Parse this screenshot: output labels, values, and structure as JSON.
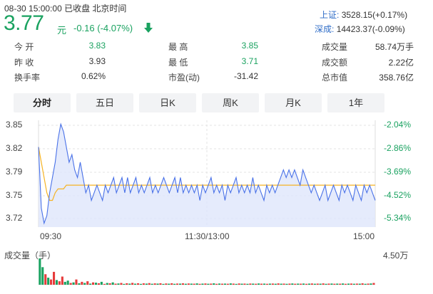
{
  "header": {
    "status": "08-30 15:00:00  已收盘  北京时间",
    "price": "3.77",
    "unit": "元",
    "change": "-0.16 (-4.07%)",
    "arrow_icon": "down-arrow-icon",
    "color_down": "#1aa260"
  },
  "indices": [
    {
      "label": "上证:",
      "value": "3528.15(+0.17%)"
    },
    {
      "label": "深成:",
      "value": "14423.37(-0.09%)"
    }
  ],
  "quote": {
    "open": {
      "label": "今 开",
      "value": "3.83"
    },
    "prev_close": {
      "label": "昨 收",
      "value": "3.93"
    },
    "turnover": {
      "label": "换手率",
      "value": "0.62%"
    },
    "high": {
      "label": "最 高",
      "value": "3.85"
    },
    "low": {
      "label": "最 低",
      "value": "3.71"
    },
    "pe": {
      "label": "市盈(动)",
      "value": "-31.42"
    },
    "volume": {
      "label": "成交量",
      "value": "58.74万手"
    },
    "amount": {
      "label": "成交额",
      "value": "2.22亿"
    },
    "market_cap": {
      "label": "总市值",
      "value": "358.76亿"
    }
  },
  "tabs": [
    {
      "label": "分时",
      "active": true
    },
    {
      "label": "五日",
      "active": false
    },
    {
      "label": "日K",
      "active": false
    },
    {
      "label": "周K",
      "active": false
    },
    {
      "label": "月K",
      "active": false
    },
    {
      "label": "1年",
      "active": false
    }
  ],
  "chart_data": {
    "type": "line",
    "y_ticks_left": [
      "3.85",
      "3.82",
      "3.79",
      "3.75",
      "3.72"
    ],
    "y_ticks_right": [
      "-2.04%",
      "-2.86%",
      "-3.69%",
      "-4.52%",
      "-5.34%"
    ],
    "x_ticks": [
      "09:30",
      "11:30/13:00",
      "15:00"
    ],
    "ylim": [
      3.715,
      3.855
    ],
    "grid": true,
    "series": [
      {
        "values": [
          3.82,
          3.74,
          3.72,
          3.73,
          3.76,
          3.78,
          3.8,
          3.83,
          3.85,
          3.84,
          3.82,
          3.8,
          3.81,
          3.79,
          3.78,
          3.8,
          3.78,
          3.76,
          3.77,
          3.75,
          3.76,
          3.77,
          3.76,
          3.75,
          3.77,
          3.76,
          3.77,
          3.78,
          3.76,
          3.77,
          3.78,
          3.76,
          3.78,
          3.76,
          3.77,
          3.78,
          3.76,
          3.77,
          3.76,
          3.77,
          3.78,
          3.76,
          3.77,
          3.76,
          3.77,
          3.78,
          3.77,
          3.76,
          3.77,
          3.78,
          3.76,
          3.78,
          3.76,
          3.77,
          3.76,
          3.77,
          3.76,
          3.77,
          3.75,
          3.77,
          3.76,
          3.77,
          3.78,
          3.76,
          3.77,
          3.76,
          3.77,
          3.75,
          3.77,
          3.76,
          3.77,
          3.78,
          3.76,
          3.77,
          3.76,
          3.77,
          3.76,
          3.78,
          3.76,
          3.77,
          3.76,
          3.75,
          3.77,
          3.76,
          3.77,
          3.76,
          3.77,
          3.78,
          3.79,
          3.78,
          3.79,
          3.78,
          3.79,
          3.78,
          3.77,
          3.79,
          3.78,
          3.77,
          3.76,
          3.77,
          3.76,
          3.75,
          3.76,
          3.77,
          3.75,
          3.76,
          3.77,
          3.76,
          3.75,
          3.77,
          3.76,
          3.77,
          3.76,
          3.75,
          3.77,
          3.76,
          3.75,
          3.77,
          3.76,
          3.77,
          3.76,
          3.75
        ]
      },
      {
        "values": [
          3.82,
          3.8,
          3.78,
          3.76,
          3.75,
          3.75,
          3.76,
          3.765,
          3.765,
          3.765,
          3.77,
          3.77,
          3.77,
          3.77,
          3.77,
          3.77,
          3.77,
          3.77,
          3.77,
          3.77,
          3.77,
          3.77,
          3.77,
          3.77,
          3.77,
          3.77,
          3.77,
          3.77,
          3.77,
          3.77,
          3.77,
          3.77,
          3.77,
          3.77,
          3.77,
          3.77,
          3.77,
          3.77,
          3.77,
          3.77,
          3.77,
          3.77,
          3.77,
          3.77,
          3.77,
          3.77,
          3.77,
          3.77,
          3.77,
          3.77,
          3.77,
          3.77,
          3.77,
          3.77,
          3.77,
          3.77,
          3.77,
          3.77,
          3.77,
          3.77,
          3.77,
          3.77,
          3.77,
          3.77,
          3.77,
          3.77,
          3.77,
          3.77,
          3.77,
          3.77,
          3.77,
          3.77,
          3.77,
          3.77,
          3.77,
          3.77,
          3.77,
          3.77,
          3.77,
          3.77,
          3.77,
          3.77,
          3.77,
          3.77,
          3.77,
          3.77,
          3.77,
          3.77,
          3.77,
          3.77,
          3.77,
          3.77,
          3.77,
          3.77,
          3.77,
          3.77,
          3.77,
          3.77,
          3.77,
          3.77,
          3.77,
          3.77,
          3.77,
          3.77,
          3.77,
          3.77,
          3.77,
          3.77,
          3.77,
          3.77,
          3.77,
          3.77,
          3.77,
          3.77,
          3.77,
          3.77,
          3.77,
          3.77,
          3.77,
          3.77,
          3.77,
          3.77
        ]
      }
    ],
    "colors": {
      "price": "#4a72e8",
      "avg": "#f5b324",
      "fill": "#dfe6fb",
      "up": "#e63b3b",
      "down": "#1aa260"
    },
    "volume": {
      "label": "成交量（手）",
      "max_label": "4.50万",
      "values": [
        45000,
        30000,
        18000,
        12000,
        9000,
        22000,
        8000,
        6000,
        14000,
        5000,
        7000,
        3000,
        4000,
        9000,
        2500,
        5000,
        3000,
        6000,
        2000,
        4000,
        3500,
        2500,
        5000,
        1500,
        3000,
        2500,
        4000,
        1800,
        2200,
        3000,
        1500,
        2500,
        2000,
        3200,
        1800,
        2600,
        1500,
        2400,
        2000,
        2800,
        1700,
        2300,
        1900,
        2600,
        1500,
        2200,
        1800,
        2500,
        1600,
        2100,
        1900,
        2400,
        1700,
        2200,
        2000,
        1800,
        2300,
        1600,
        2000,
        2200,
        1700,
        1900,
        2400,
        1600,
        2100,
        1800,
        2000,
        1700,
        2300,
        1900,
        1500,
        2200,
        1800,
        2000,
        1600,
        2100,
        1900,
        1700,
        2200,
        1800,
        2000,
        1600,
        1900,
        2100,
        1700,
        2300,
        1800,
        2000,
        1600,
        1900,
        2200,
        1700,
        2000,
        1800,
        2100,
        1600,
        1900,
        2200,
        1700,
        2000,
        1800,
        2300,
        1600,
        1900,
        2100,
        1700,
        2000,
        1800,
        2200,
        1600,
        1900,
        2100,
        1700,
        2000,
        1800,
        2400,
        1600,
        2000,
        2200,
        3000
      ],
      "directions": [
        "d",
        "d",
        "u",
        "d",
        "u",
        "u",
        "d",
        "u",
        "u",
        "d",
        "d",
        "u",
        "d",
        "u",
        "d",
        "u",
        "d",
        "u",
        "d",
        "u",
        "d",
        "u",
        "d",
        "u",
        "d",
        "u",
        "d",
        "u",
        "d",
        "u",
        "d",
        "u",
        "d",
        "u",
        "d",
        "u",
        "d",
        "u",
        "d",
        "u",
        "d",
        "u",
        "d",
        "u",
        "d",
        "u",
        "d",
        "u",
        "d",
        "u",
        "d",
        "u",
        "d",
        "u",
        "d",
        "u",
        "d",
        "u",
        "d",
        "u",
        "d",
        "u",
        "d",
        "u",
        "d",
        "u",
        "d",
        "u",
        "d",
        "u",
        "d",
        "u",
        "d",
        "u",
        "d",
        "u",
        "d",
        "u",
        "d",
        "u",
        "d",
        "u",
        "d",
        "u",
        "d",
        "u",
        "d",
        "u",
        "d",
        "u",
        "d",
        "u",
        "d",
        "u",
        "d",
        "u",
        "d",
        "u",
        "d",
        "u",
        "d",
        "u",
        "d",
        "u",
        "d",
        "u",
        "d",
        "u",
        "d",
        "u",
        "d",
        "u",
        "d",
        "u",
        "d",
        "u",
        "d",
        "u",
        "d",
        "u"
      ]
    }
  }
}
